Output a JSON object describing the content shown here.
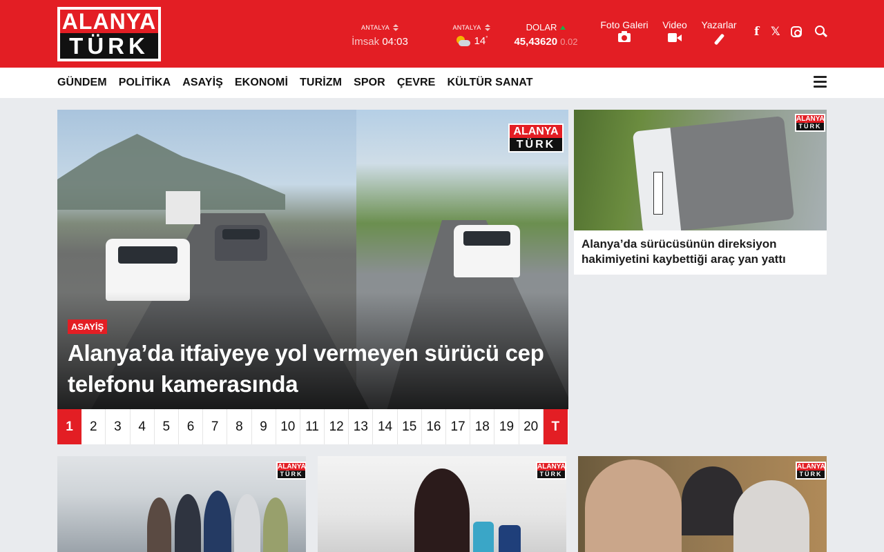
{
  "logo": {
    "top": "ALANYA",
    "bottom": "TÜRK"
  },
  "header": {
    "prayer": {
      "city": "ANTALYA",
      "label": "İmsak",
      "time": "04:03"
    },
    "weather": {
      "city": "ANTALYA",
      "temp": "14",
      "unit": "°"
    },
    "currency": {
      "name": "DOLAR",
      "value": "45,43620",
      "change": "0.02"
    },
    "links": [
      {
        "label": "Foto Galeri",
        "icon": "camera-icon"
      },
      {
        "label": "Video",
        "icon": "video-icon"
      },
      {
        "label": "Yazarlar",
        "icon": "pen-icon"
      }
    ],
    "social": {
      "facebook": "f",
      "x": "𝕏"
    }
  },
  "nav": {
    "items": [
      "GÜNDEM",
      "POLİTİKA",
      "ASAYİŞ",
      "EKONOMİ",
      "TURİZM",
      "SPOR",
      "ÇEVRE",
      "KÜLTÜR SANAT"
    ]
  },
  "hero": {
    "category": "ASAYİŞ",
    "title": "Alanya’da itfaiyeye yol vermeyen sürücü cep telefonu kamerasında",
    "watermark_top": "ALANYA",
    "watermark_bottom": "TÜRK"
  },
  "pager": {
    "pages": [
      "1",
      "2",
      "3",
      "4",
      "5",
      "6",
      "7",
      "8",
      "9",
      "10",
      "11",
      "12",
      "13",
      "14",
      "15",
      "16",
      "17",
      "18",
      "19",
      "20"
    ],
    "active": "1",
    "last": "T"
  },
  "side_news": {
    "title": "Alanya’da sürücüsünün direksiyon hakimiyetini kaybettiği araç yan yattı"
  },
  "colors": {
    "brand": "#e31e24",
    "nav_bg": "#ffffff",
    "page_bg": "#e9ebee"
  }
}
